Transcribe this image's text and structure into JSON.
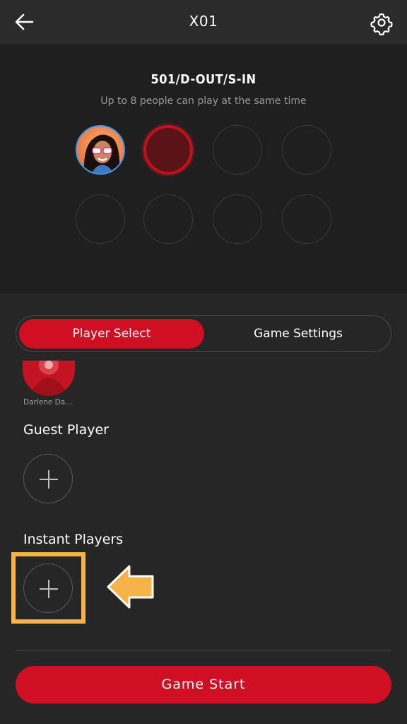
{
  "header": {
    "title": "X01",
    "back_icon": "arrow-left-icon",
    "settings_icon": "gear-icon"
  },
  "game": {
    "mode": "501/D-OUT/S-IN",
    "subtitle": "Up to 8 people can play at the same time"
  },
  "tabs": [
    {
      "label": "Player Select",
      "active": true
    },
    {
      "label": "Game Settings",
      "active": false
    }
  ],
  "players": {
    "partial_name": "Darlene Da…"
  },
  "sections": {
    "guest_label": "Guest Player",
    "instant_label": "Instant Players"
  },
  "footer": {
    "start_label": "Game Start"
  },
  "colors": {
    "accent": "#d10f22",
    "highlight": "#f7b34a",
    "background": "#262626"
  }
}
